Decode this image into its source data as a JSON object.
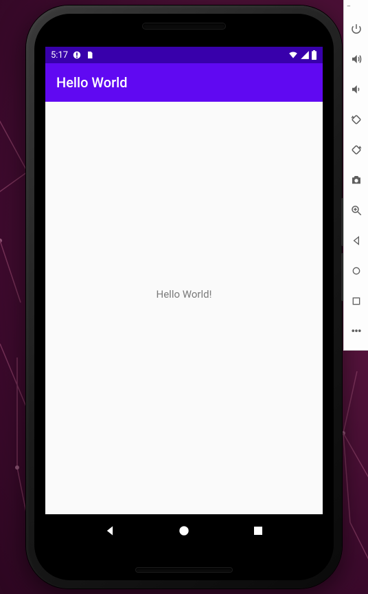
{
  "status_bar": {
    "time": "5:17",
    "icons_left": [
      "debug",
      "file"
    ],
    "icons_right": [
      "wifi",
      "cell-signal",
      "battery"
    ]
  },
  "app_bar": {
    "title": "Hello World"
  },
  "content": {
    "greeting": "Hello World!"
  },
  "nav_bar": {
    "buttons": [
      "back",
      "home",
      "recents"
    ]
  },
  "emulator_sidebar": {
    "buttons": [
      "power",
      "volume-up",
      "volume-down",
      "rotate-left",
      "rotate-right",
      "screenshot",
      "zoom",
      "back",
      "home",
      "overview",
      "more"
    ]
  }
}
